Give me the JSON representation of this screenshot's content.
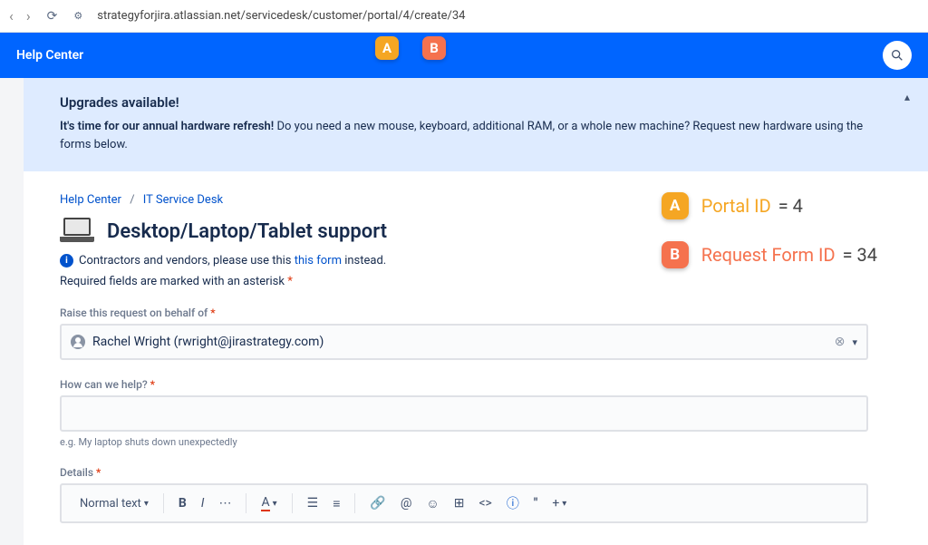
{
  "browser": {
    "url": "strategyforjira.atlassian.net/servicedesk/customer/portal/4/create/34"
  },
  "header": {
    "help_center": "Help Center"
  },
  "banner": {
    "title": "Upgrades available!",
    "bold_lead": "It's time for our annual hardware refresh!",
    "rest": " Do you need a new mouse, keyboard, additional RAM, or a whole new machine? Request new hardware using the forms below."
  },
  "breadcrumb": {
    "home": "Help Center",
    "desk": "IT Service Desk"
  },
  "page": {
    "title": "Desktop/Laptop/Tablet support",
    "contractor_lead": "Contractors and vendors, please use this ",
    "contractor_link": "this form",
    "contractor_tail": " instead.",
    "required_note": "Required fields are marked with an asterisk"
  },
  "fields": {
    "behalf_label": "Raise this request on behalf of",
    "behalf_value": "Rachel Wright (rwright@jirastrategy.com)",
    "help_label": "How can we help?",
    "help_hint": "e.g. My laptop shuts down unexpectedly",
    "details_label": "Details",
    "rte_style": "Normal text"
  },
  "annotations": {
    "a_letter": "A",
    "b_letter": "B",
    "a_label": "Portal ID",
    "a_value": "= 4",
    "b_label": "Request Form ID",
    "b_value": "= 34"
  }
}
